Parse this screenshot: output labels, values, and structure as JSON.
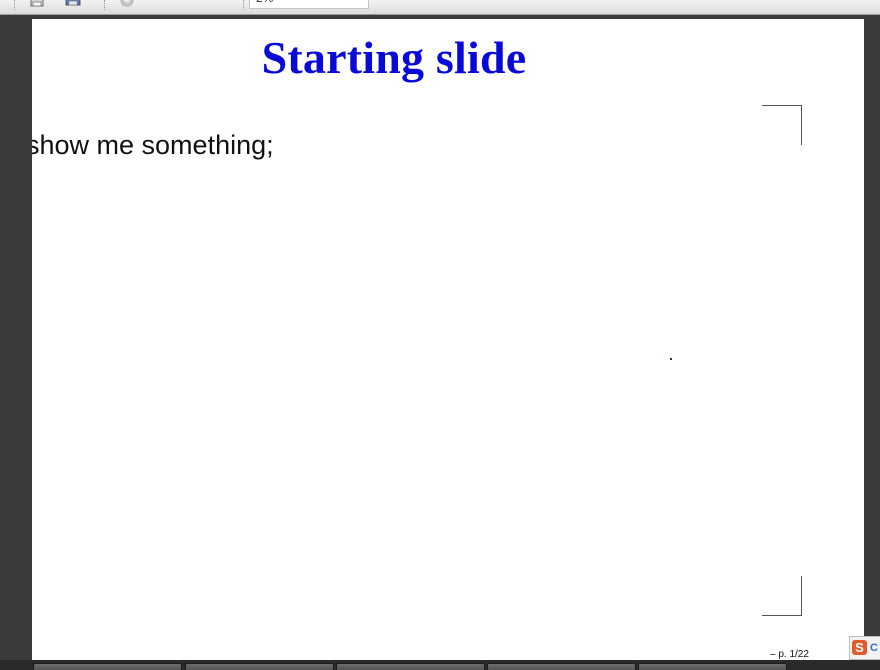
{
  "toolbar": {
    "zoom_value": "2%",
    "icons": [
      "save-icon",
      "print-icon",
      "settings-icon"
    ]
  },
  "slide": {
    "title": "Starting slide",
    "body_text": "show me something;",
    "page_number": "– p. 1/22",
    "title_color": "#0a0ad8"
  },
  "tray": {
    "s_label": "S",
    "s2_label": "C"
  }
}
